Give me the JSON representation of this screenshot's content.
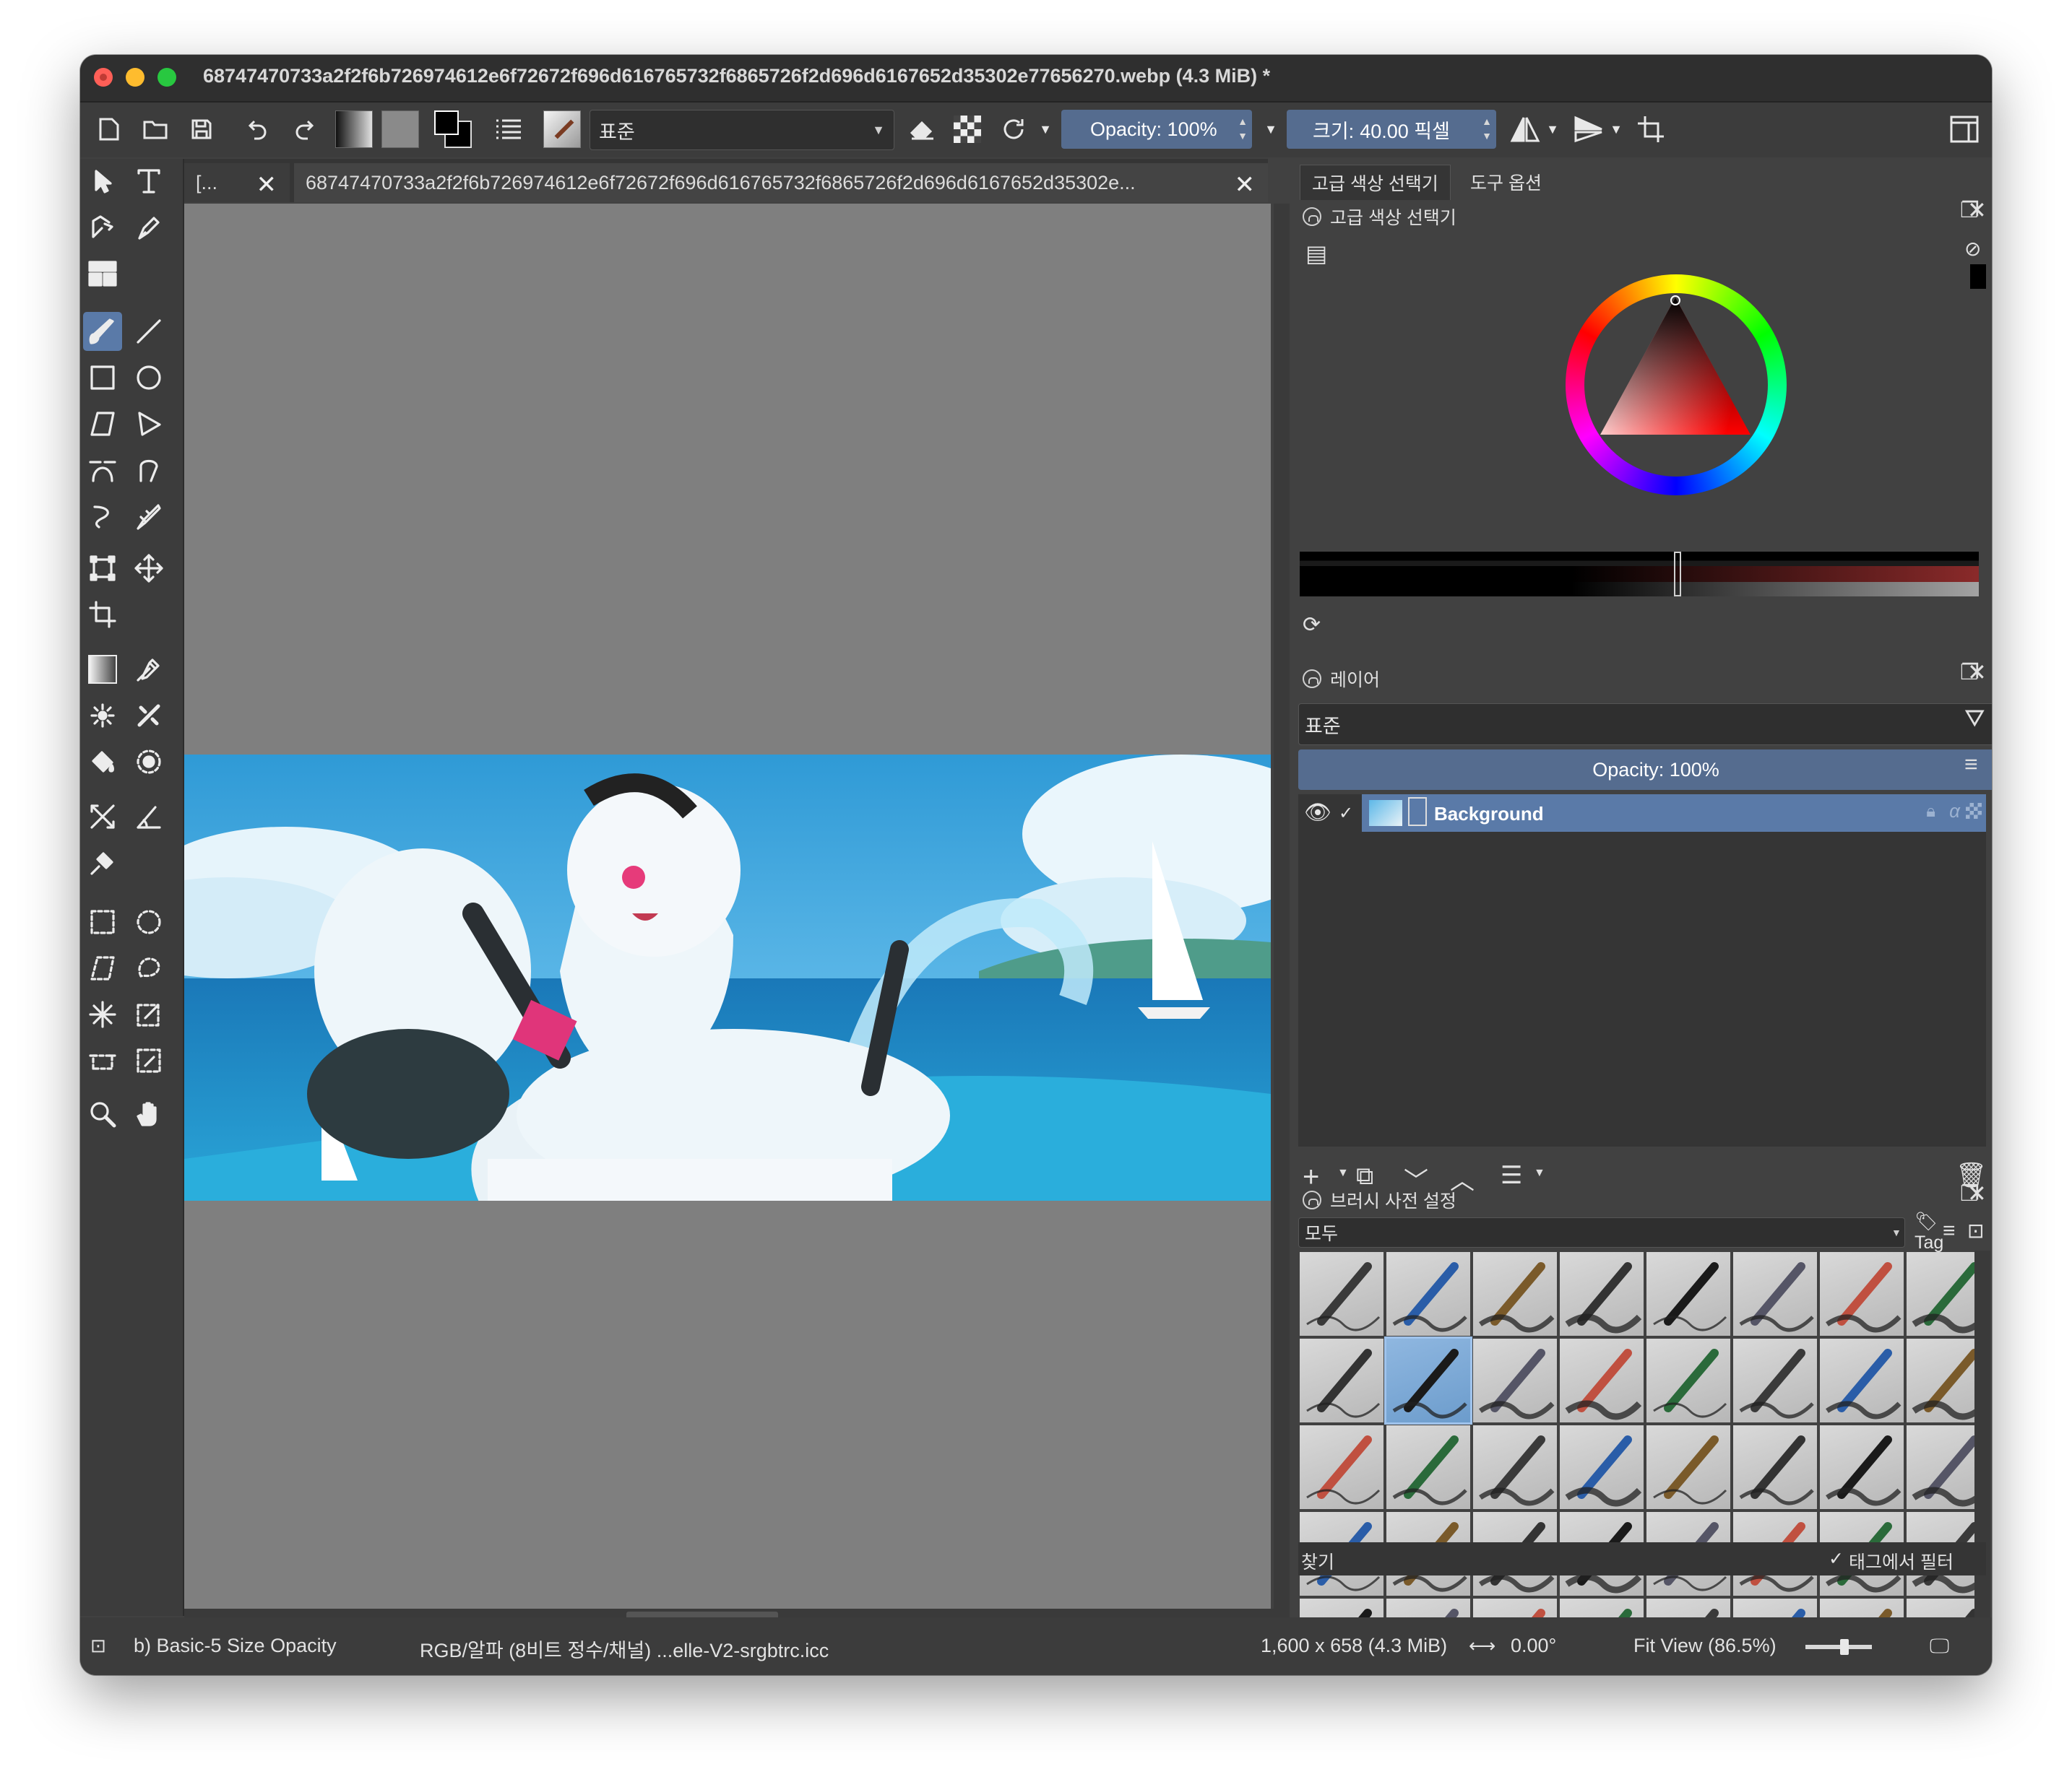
{
  "window": {
    "title": "68747470733a2f2f6b726974612e6f72672f696d616765732f6865726f2d696d6167652d35302e77656270.webp (4.3 MiB) *"
  },
  "toolbar": {
    "blend_mode": "표준",
    "opacity": "Opacity: 100%",
    "size_label": "크기:",
    "size_value": "40.00 픽셀"
  },
  "document_tabs": [
    {
      "label": "[..."
    },
    {
      "label": "68747470733a2f2f6b726974612e6f72672f696d616765732f6865726f2d696d6167652d35302e..."
    }
  ],
  "dock": {
    "tabs": [
      "고급 색상 선택기",
      "도구 옵션"
    ],
    "color_selector_title": "고급 색상 선택기",
    "layers": {
      "title": "레이어",
      "blend_mode": "표준",
      "opacity": "Opacity: 100%",
      "items": [
        {
          "name": "Background",
          "visible": true,
          "selected": true
        }
      ]
    },
    "brush_presets": {
      "title": "브러시 사전 설정",
      "filter": "모두",
      "tag_label": "Tag",
      "search_label": "찾기",
      "filter_by_tag": "태그에서 필터",
      "filter_checked": true
    }
  },
  "status": {
    "brush": "b) Basic-5 Size Opacity",
    "color_profile": "RGB/알파 (8비트 정수/채널) ...elle-V2-srgbtrc.icc",
    "image_size": "1,600 x 658 (4.3 MiB)",
    "rotation": "0.00°",
    "zoom": "Fit View (86.5%)"
  },
  "colors": {
    "accent": "#556c8f",
    "selection": "#5a7aa8",
    "panel": "#414141",
    "canvas_bg": "#7f7f7f"
  }
}
